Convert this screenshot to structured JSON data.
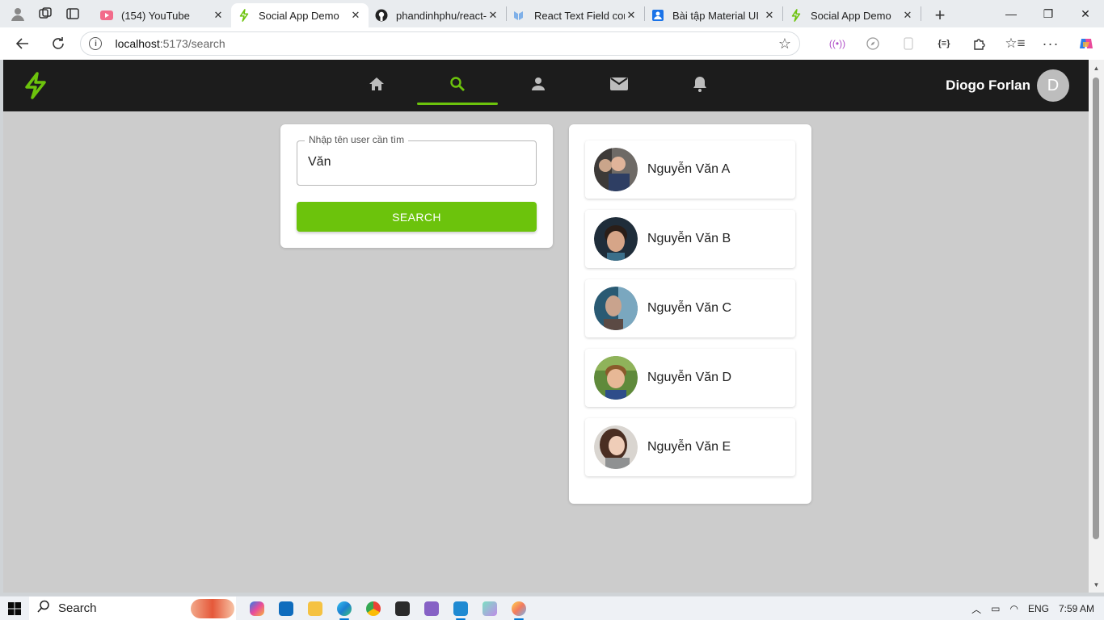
{
  "browser": {
    "tabs": [
      {
        "title": "(154) YouTube",
        "icon": "youtube-icon",
        "active": false
      },
      {
        "title": "Social App Demo",
        "icon": "bolt-icon",
        "active": true
      },
      {
        "title": "phandinhphu/react-",
        "icon": "github-icon",
        "active": false
      },
      {
        "title": "React Text Field com",
        "icon": "mui-icon",
        "active": false
      },
      {
        "title": "Bài tập Material UI",
        "icon": "classroom-icon",
        "active": false
      },
      {
        "title": "Social App Demo",
        "icon": "bolt-icon",
        "active": false
      }
    ],
    "url_host": "localhost",
    "url_path": ":5173/search"
  },
  "app": {
    "accent_color": "#6cc30c",
    "nav": [
      {
        "name": "home",
        "icon": "home-icon",
        "active": false
      },
      {
        "name": "search",
        "icon": "search-icon",
        "active": true
      },
      {
        "name": "profile",
        "icon": "person-icon",
        "active": false
      },
      {
        "name": "messages",
        "icon": "mail-icon",
        "active": false
      },
      {
        "name": "notifications",
        "icon": "bell-icon",
        "active": false
      }
    ],
    "user": {
      "name": "Diogo Forlan",
      "initial": "D"
    }
  },
  "search": {
    "label": "Nhập tên user cần tìm",
    "value": "Văn",
    "button_label": "SEARCH"
  },
  "results": [
    {
      "name": "Nguyễn Văn A"
    },
    {
      "name": "Nguyễn Văn B"
    },
    {
      "name": "Nguyễn Văn C"
    },
    {
      "name": "Nguyễn Văn D"
    },
    {
      "name": "Nguyễn Văn E"
    }
  ],
  "taskbar": {
    "search_label": "Search",
    "language": "ENG",
    "time": "7:59 AM"
  }
}
